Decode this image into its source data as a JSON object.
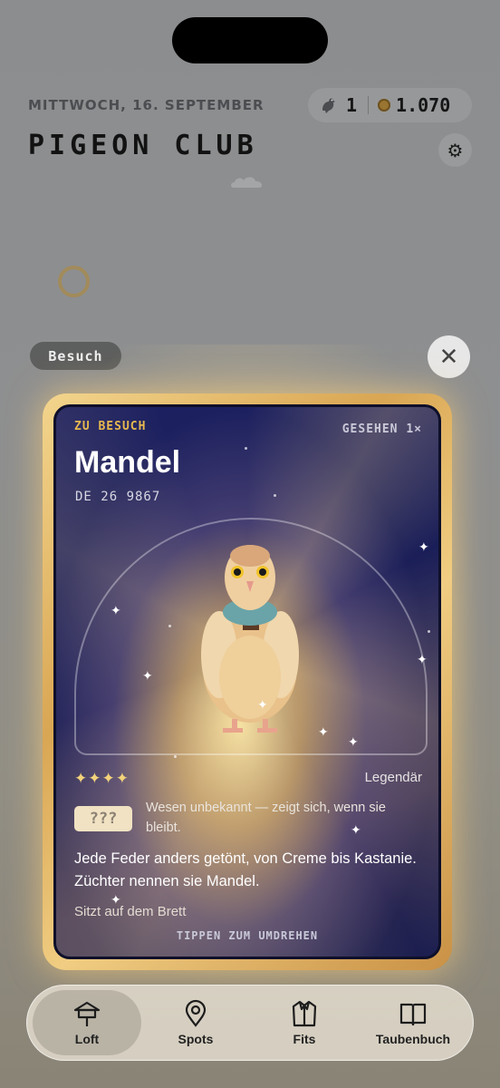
{
  "header": {
    "date": "MITTWOCH, 16. SEPTEMBER",
    "title": "PIGEON CLUB",
    "pigeon_count": "1",
    "coins": "1.070"
  },
  "badge": {
    "label": "Besuch"
  },
  "card": {
    "status": "ZU BESUCH",
    "seen": "GESEHEN 1×",
    "name": "Mandel",
    "ring_id": "DE 26 9867",
    "rating_stars": "✦✦✦✦",
    "rarity": "Legendär",
    "unknown_badge": "???",
    "unknown_text": "Wesen unbekannt — zeigt sich, wenn sie bleibt.",
    "description": "Jede Feder anders getönt, von Creme bis Kastanie. Züchter nennen sie Mandel.",
    "location": "Sitzt auf dem Brett",
    "flip_hint": "TIPPEN ZUM UMDREHEN"
  },
  "tabs": [
    {
      "label": "Loft",
      "icon": "loft-icon",
      "active": true
    },
    {
      "label": "Spots",
      "icon": "map-pin-icon",
      "active": false
    },
    {
      "label": "Fits",
      "icon": "jacket-icon",
      "active": false
    },
    {
      "label": "Taubenbuch",
      "icon": "book-icon",
      "active": false
    }
  ],
  "colors": {
    "card_gold": "#e7b84f",
    "card_navy": "#1d2161",
    "tabbar": "#dcd6c8"
  }
}
